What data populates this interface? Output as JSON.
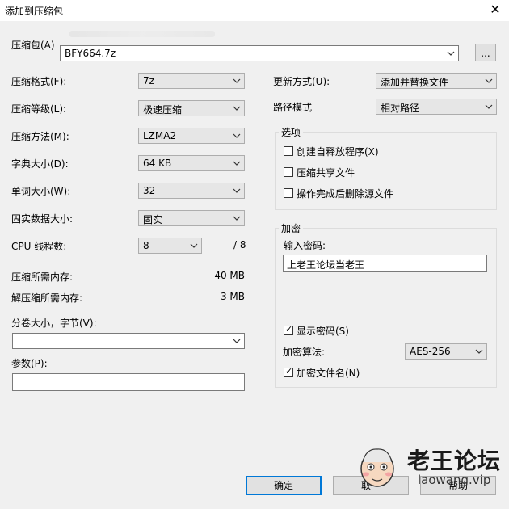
{
  "window": {
    "title": "添加到压缩包",
    "close_glyph": "✕"
  },
  "archive": {
    "label": "压缩包(A)",
    "value": "BFY664.7z",
    "browse_label": "..."
  },
  "left": {
    "format": {
      "label": "压缩格式(F):",
      "value": "7z"
    },
    "level": {
      "label": "压缩等级(L):",
      "value": "极速压缩"
    },
    "method": {
      "label": "压缩方法(M):",
      "value": "LZMA2"
    },
    "dict": {
      "label": "字典大小(D):",
      "value": "64 KB"
    },
    "word": {
      "label": "单词大小(W):",
      "value": "32"
    },
    "solid": {
      "label": "固实数据大小:",
      "value": "固实"
    },
    "threads": {
      "label": "CPU 线程数:",
      "value": "8",
      "total": "/ 8"
    },
    "mem_compress": {
      "label": "压缩所需内存:",
      "value": "40 MB"
    },
    "mem_decompress": {
      "label": "解压缩所需内存:",
      "value": "3 MB"
    },
    "volume": {
      "label": "分卷大小，字节(V):",
      "value": ""
    },
    "params": {
      "label": "参数(P):",
      "value": ""
    }
  },
  "right": {
    "update": {
      "label": "更新方式(U):",
      "value": "添加并替换文件"
    },
    "path": {
      "label": "路径模式",
      "value": "相对路径"
    },
    "options": {
      "legend": "选项",
      "items": [
        {
          "label": "创建自释放程序(X)",
          "checked": false
        },
        {
          "label": "压缩共享文件",
          "checked": false
        },
        {
          "label": "操作完成后删除源文件",
          "checked": false
        }
      ]
    },
    "encryption": {
      "legend": "加密",
      "password_label": "输入密码:",
      "password_value": "上老王论坛当老王",
      "show_password": {
        "label": "显示密码(S)",
        "checked": true
      },
      "method_label": "加密算法:",
      "method_value": "AES-256",
      "encrypt_names": {
        "label": "加密文件名(N)",
        "checked": true
      }
    }
  },
  "buttons": {
    "ok": "确定",
    "cancel": "取",
    "help": "帮助"
  },
  "watermark": {
    "name": "老王论坛",
    "url": "laowang.vip"
  },
  "icons": {
    "dropdown": "chevron-down-icon",
    "check": "checkmark-icon"
  }
}
